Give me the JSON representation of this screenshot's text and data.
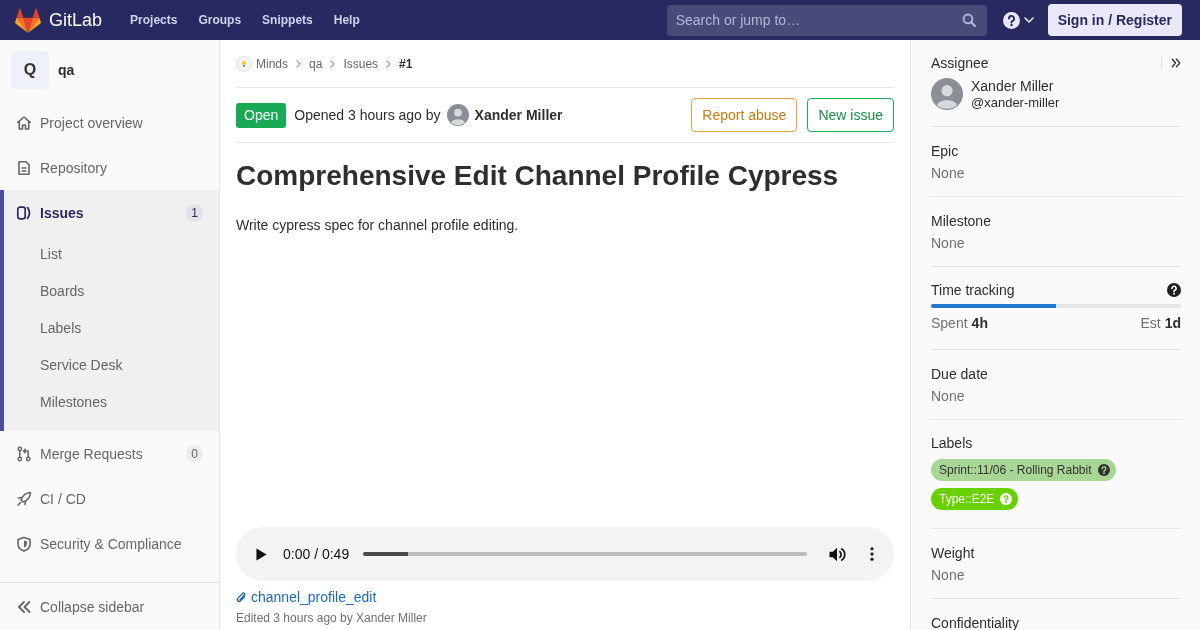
{
  "top_bar": {
    "brand": "GitLab",
    "nav": [
      {
        "label": "Projects"
      },
      {
        "label": "Groups"
      },
      {
        "label": "Snippets"
      },
      {
        "label": "Help"
      }
    ],
    "search": {
      "placeholder": "Search or jump to…"
    },
    "sign_in": "Sign in / Register"
  },
  "project": {
    "initial": "Q",
    "name": "qa"
  },
  "sidebar": {
    "items": [
      {
        "kind": "home",
        "label": "Project overview",
        "selected": false
      },
      {
        "kind": "document",
        "label": "Repository",
        "selected": false
      },
      {
        "kind": "issues",
        "label": "Issues",
        "selected": true,
        "count": "1",
        "children": [
          {
            "label": "List",
            "selected": false
          },
          {
            "label": "Boards",
            "selected": false
          },
          {
            "label": "Labels",
            "selected": false
          },
          {
            "label": "Service Desk",
            "selected": false
          },
          {
            "label": "Milestones",
            "selected": false
          }
        ]
      },
      {
        "kind": "merge",
        "label": "Merge Requests",
        "selected": false,
        "count": "0"
      },
      {
        "kind": "rocket",
        "label": "CI / CD",
        "selected": false
      },
      {
        "kind": "shield",
        "label": "Security & Compliance",
        "selected": false
      }
    ],
    "collapse": "Collapse sidebar"
  },
  "breadcrumbs": [
    {
      "label": "Minds"
    },
    {
      "label": "qa"
    },
    {
      "label": "Issues"
    },
    {
      "label": "#1"
    }
  ],
  "issue": {
    "status": "Open",
    "opened_text": "Opened 3 hours ago by",
    "author": "Xander Miller",
    "buttons": [
      {
        "kind": "report",
        "label": "Report abuse"
      },
      {
        "kind": "create",
        "label": "New issue"
      }
    ],
    "title": "Comprehensive Edit Channel Profile Cypress",
    "description": "Write cypress spec for channel profile editing.",
    "audio": {
      "time": "0:00 / 0:49",
      "level": 0.1
    },
    "attachment": "channel_profile_edit",
    "edited": "Edited 3 hours ago by Xander Miller"
  },
  "issue_sidebar": {
    "sections": [
      {
        "kind": "assignee",
        "heading": "Assignee",
        "name": "Xander Miller",
        "username": "@xander-miller"
      },
      {
        "kind": "value",
        "heading": "Epic",
        "value": "None"
      },
      {
        "kind": "value",
        "heading": "Milestone",
        "value": "None"
      },
      {
        "kind": "time",
        "heading": "Time tracking",
        "level": 0.5,
        "spent_label": "Spent",
        "spent": "4h",
        "estimate_label": "Est",
        "estimate": "1d"
      },
      {
        "kind": "value",
        "heading": "Due date",
        "value": "None"
      },
      {
        "kind": "labels",
        "heading": "Labels",
        "labels": [
          {
            "text": "Sprint::11/06 - Rolling Rabbit",
            "color": "#a8d695"
          },
          {
            "text": "Type::E2E",
            "color": "#69d100"
          }
        ]
      },
      {
        "kind": "value",
        "heading": "Weight",
        "value": "None"
      },
      {
        "kind": "heading",
        "heading": "Confidentiality"
      }
    ]
  }
}
